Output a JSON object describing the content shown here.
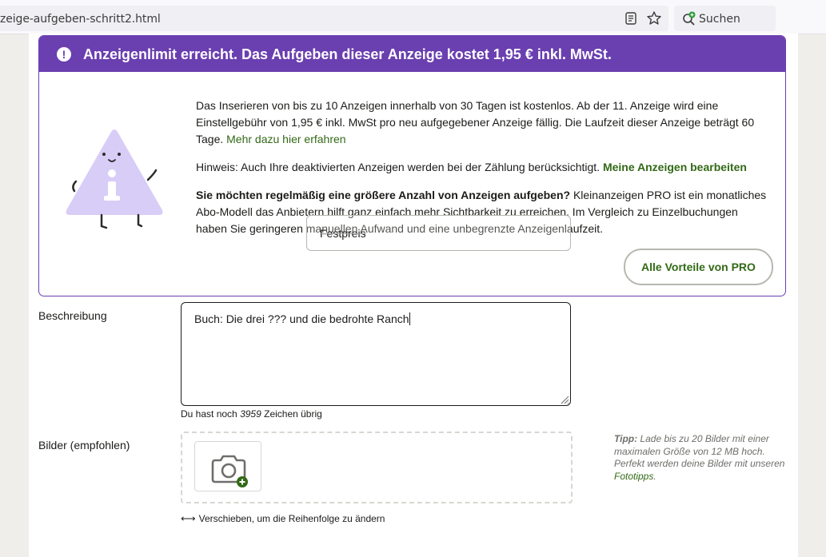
{
  "browser": {
    "url": "zeige-aufgeben-schritt2.html",
    "search_placeholder": "Suchen"
  },
  "notice": {
    "title": "Anzeigenlimit erreicht. Das Aufgeben dieser Anzeige kostet 1,95 € inkl. MwSt.",
    "paragraph1_text": "Das Inserieren von bis zu 10 Anzeigen innerhalb von 30 Tagen ist kostenlos. Ab der 11. Anzeige wird eine Einstellgebühr von 1,95 € inkl. MwSt pro neu aufgegebener Anzeige fällig. Die Laufzeit dieser Anzeige beträgt 60 Tage.",
    "paragraph1_link": "Mehr dazu hier erfahren",
    "paragraph2_text": "Hinweis: Auch Ihre deaktivierten Anzeigen werden bei der Zählung berücksichtigt.",
    "paragraph2_link": "Meine Anzeigen bearbeiten",
    "paragraph3_bold": "Sie möchten regelmäßig eine größere Anzahl von Anzeigen aufgeben?",
    "paragraph3_text": "Kleinanzeigen PRO ist ein monatliches Abo-Modell das Anbietern hilft ganz einfach mehr Sichtbarkeit zu erreichen. Im Vergleich zu Einzelbuchungen haben Sie geringeren manuellen Aufwand und eine unbegrenzte Anzeigenlaufzeit.",
    "pro_button": "Alle Vorteile von PRO"
  },
  "overlay_field": {
    "value": "Festpreis"
  },
  "form": {
    "description_label": "Beschreibung",
    "description_value": "Buch: Die drei ??? und die bedrohte Ranch",
    "counter_prefix": "Du hast noch",
    "counter_value": "3959",
    "counter_suffix": "Zeichen übrig",
    "images_label": "Bilder (empfohlen)",
    "reorder_hint": "Verschieben, um die Reihenfolge zu ändern",
    "tip_label": "Tipp:",
    "tip_text": "Lade bis zu 20 Bilder mit einer maximalen Größe von 12 MB hoch. Perfekt werden deine Bilder mit unseren",
    "tip_link": "Fototipps",
    "tip_end": "."
  },
  "colors": {
    "accent_purple": "#6a3fb0",
    "link_green": "#326916",
    "mascot_lilac": "#d8cdf7"
  }
}
